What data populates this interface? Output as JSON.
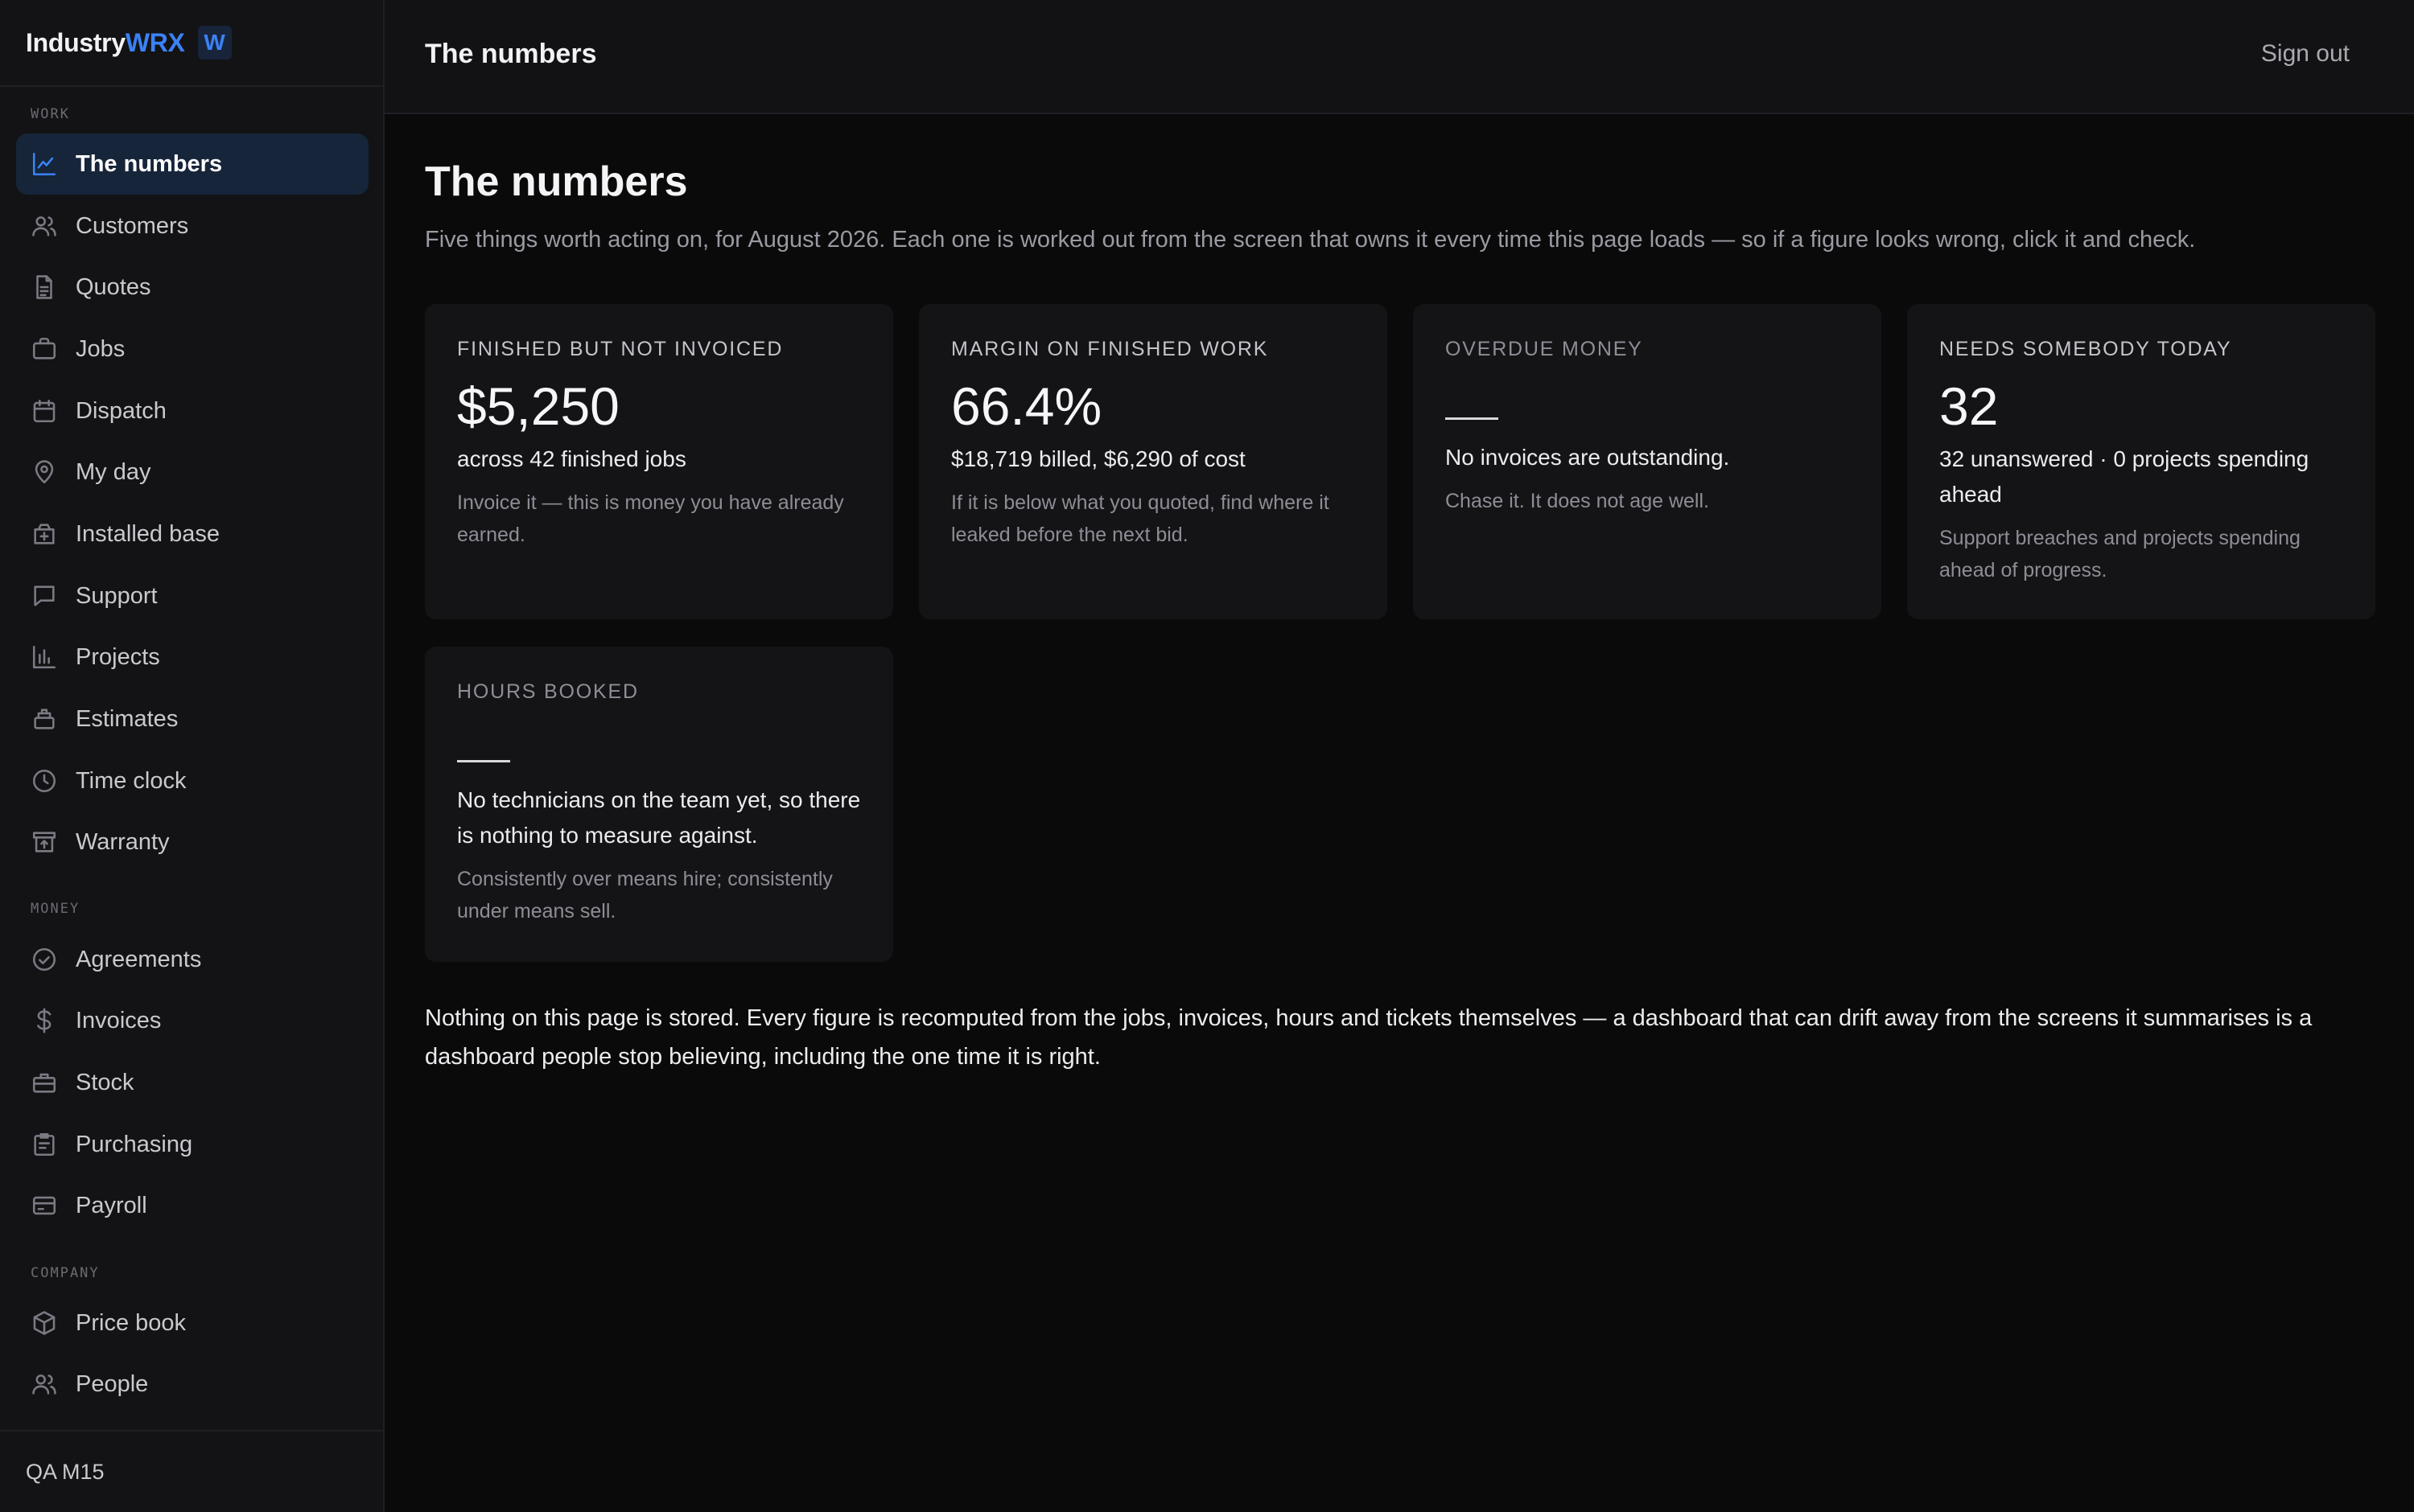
{
  "brand": {
    "name_prefix": "Industry",
    "name_accent": "WRX",
    "badge": "W",
    "accent_color": "#3b82f6"
  },
  "sidebar": {
    "sections": {
      "work": "WORK",
      "money": "MONEY",
      "company": "COMPANY"
    },
    "items": [
      {
        "label": "The numbers",
        "icon": "line-chart-icon",
        "active": true
      },
      {
        "label": "Customers",
        "icon": "users-icon"
      },
      {
        "label": "Quotes",
        "icon": "document-icon"
      },
      {
        "label": "Jobs",
        "icon": "briefcase-icon"
      },
      {
        "label": "Dispatch",
        "icon": "calendar-icon"
      },
      {
        "label": "My day",
        "icon": "map-pin-icon"
      },
      {
        "label": "Installed base",
        "icon": "package-plus-icon"
      },
      {
        "label": "Support",
        "icon": "chat-bubble-icon"
      },
      {
        "label": "Projects",
        "icon": "bar-chart-icon"
      },
      {
        "label": "Estimates",
        "icon": "clipboard-stack-icon"
      },
      {
        "label": "Time clock",
        "icon": "clock-icon"
      },
      {
        "label": "Warranty",
        "icon": "archive-icon"
      },
      {
        "label": "Agreements",
        "icon": "check-circle-icon"
      },
      {
        "label": "Invoices",
        "icon": "dollar-icon"
      },
      {
        "label": "Stock",
        "icon": "toolbox-icon"
      },
      {
        "label": "Purchasing",
        "icon": "clipboard-list-icon"
      },
      {
        "label": "Payroll",
        "icon": "card-icon"
      },
      {
        "label": "Price book",
        "icon": "cube-icon"
      },
      {
        "label": "People",
        "icon": "people-icon"
      }
    ],
    "footer": "QA M15"
  },
  "topbar": {
    "title": "The numbers",
    "signout": "Sign out"
  },
  "main": {
    "title": "The numbers",
    "subtitle": "Five things worth acting on, for August 2026. Each one is worked out from the screen that owns it every time this page loads — so if a figure looks wrong, click it and check.",
    "cards": [
      {
        "label": "FINISHED BUT NOT INVOICED",
        "value": "$5,250",
        "detail": "across 42 finished jobs",
        "note": "Invoice it — this is money you have already earned."
      },
      {
        "label": "MARGIN ON FINISHED WORK",
        "value": "66.4%",
        "detail": "$18,719 billed, $6,290 of cost",
        "note": "If it is below what you quoted, find where it leaked before the next bid."
      },
      {
        "label": "OVERDUE MONEY",
        "value": "",
        "detail": "No invoices are outstanding.",
        "note": "Chase it. It does not age well."
      },
      {
        "label": "NEEDS SOMEBODY TODAY",
        "value": "32",
        "detail": "32 unanswered · 0 projects spending ahead",
        "note": "Support breaches and projects spending ahead of progress."
      },
      {
        "label": "HOURS BOOKED",
        "value": "",
        "detail": "No technicians on the team yet, so there is nothing to measure against.",
        "note": "Consistently over means hire; consistently under means sell."
      }
    ],
    "footnote": "Nothing on this page is stored. Every figure is recomputed from the jobs, invoices, hours and tickets themselves — a dashboard that can drift away from the screens it summarises is a dashboard people stop believing, including the one time it is right."
  }
}
